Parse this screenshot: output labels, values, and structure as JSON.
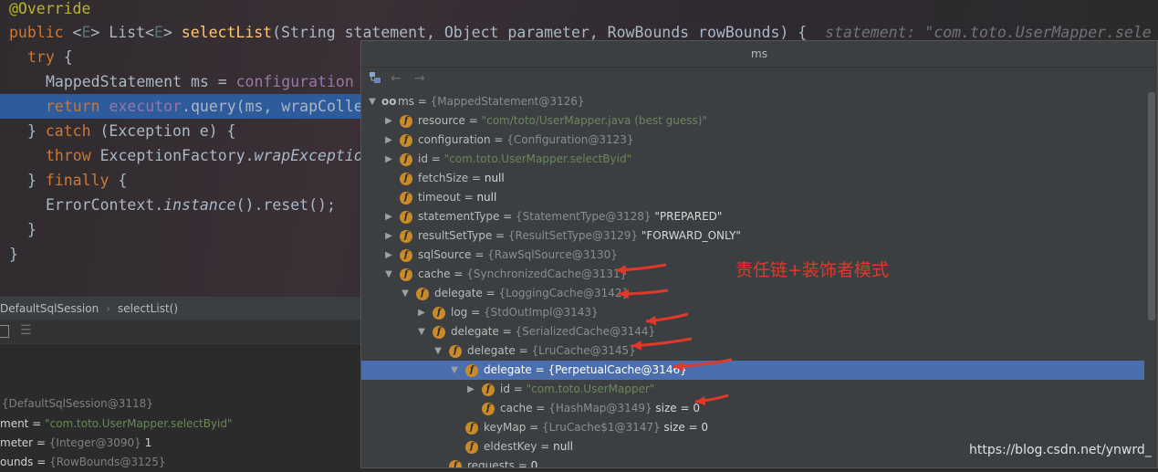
{
  "editor": {
    "lines": {
      "l1": {
        "ann": "@Override"
      },
      "l2": {
        "kw": "public",
        "gen_open": " <",
        "gen": "E",
        "gen_close": "> List<",
        "gen2": "E",
        "gen2_close": "> ",
        "fn": "selectList",
        "args": "(String statement, Object parameter, RowBounds rowBounds) {",
        "hint": "statement: \"com.toto.UserMapper.sele"
      },
      "l3": {
        "kw": "try",
        "rest": " {"
      },
      "l4": {
        "text": "MappedStatement ms = ",
        "field": "configuration"
      },
      "l5": {
        "kw": "return ",
        "field": "executor",
        "rest": ".query(ms, wrapColle"
      },
      "l6": {
        "pre": "} ",
        "kw": "catch",
        "rest": " (Exception e) {"
      },
      "l7": {
        "kw": "throw ",
        "text": "ExceptionFactory.",
        "it": "wrapExceptio"
      },
      "l8": {
        "pre": "} ",
        "kw": "finally",
        "rest": " {"
      },
      "l9": {
        "text": "ErrorContext.",
        "it": "instance",
        "rest": "().reset();"
      },
      "l10": {
        "text": "}"
      },
      "l11": {
        "text": "}"
      }
    }
  },
  "breadcrumb": {
    "class_name": "DefaultSqlSession",
    "method": "selectList()"
  },
  "variables": {
    "rows": [
      {
        "name": "",
        "type": "{DefaultSqlSession@3118}",
        "value": ""
      },
      {
        "name": "ment = ",
        "type": "",
        "value": "\"com.toto.UserMapper.selectByid\""
      },
      {
        "name": "meter = ",
        "type": "{Integer@3090}",
        "value": " 1"
      },
      {
        "name": "ounds = ",
        "type": "{RowBounds@3125}",
        "value": ""
      }
    ]
  },
  "popup": {
    "title": "ms",
    "toolbar": {
      "back": "←",
      "forward": "→"
    },
    "tree": [
      {
        "name": "ms",
        "eq": " = ",
        "type": "{MappedStatement@3126}",
        "str": "",
        "plain": ""
      },
      {
        "name": "resource",
        "eq": " = ",
        "type": "",
        "str": "\"com/toto/UserMapper.java (best guess)\"",
        "plain": ""
      },
      {
        "name": "configuration",
        "eq": " = ",
        "type": "{Configuration@3123}",
        "str": "",
        "plain": ""
      },
      {
        "name": "id",
        "eq": " = ",
        "type": "",
        "str": "\"com.toto.UserMapper.selectByid\"",
        "plain": ""
      },
      {
        "name": "fetchSize",
        "eq": " = ",
        "type": "",
        "str": "",
        "plain": "null"
      },
      {
        "name": "timeout",
        "eq": " = ",
        "type": "",
        "str": "",
        "plain": "null"
      },
      {
        "name": "statementType",
        "eq": " = ",
        "type": "{StatementType@3128}",
        "str": "",
        "plain": " \"PREPARED\""
      },
      {
        "name": "resultSetType",
        "eq": " = ",
        "type": "{ResultSetType@3129}",
        "str": "",
        "plain": " \"FORWARD_ONLY\""
      },
      {
        "name": "sqlSource",
        "eq": " = ",
        "type": "{RawSqlSource@3130}",
        "str": "",
        "plain": ""
      },
      {
        "name": "cache",
        "eq": " = ",
        "type": "{SynchronizedCache@3131}",
        "str": "",
        "plain": ""
      },
      {
        "name": "delegate",
        "eq": " = ",
        "type": "{LoggingCache@3142}",
        "str": "",
        "plain": ""
      },
      {
        "name": "log",
        "eq": " = ",
        "type": "{StdOutImpl@3143}",
        "str": "",
        "plain": ""
      },
      {
        "name": "delegate",
        "eq": " = ",
        "type": "{SerializedCache@3144}",
        "str": "",
        "plain": ""
      },
      {
        "name": "delegate",
        "eq": " = ",
        "type": "{LruCache@3145}",
        "str": "",
        "plain": ""
      },
      {
        "name": "delegate",
        "eq": " = ",
        "type": "{PerpetualCache@3146}",
        "str": "",
        "plain": ""
      },
      {
        "name": "id",
        "eq": " = ",
        "type": "",
        "str": "\"com.toto.UserMapper\"",
        "plain": ""
      },
      {
        "name": "cache",
        "eq": " = ",
        "type": "{HashMap@3149}",
        "str": "",
        "plain": "  size = 0"
      },
      {
        "name": "keyMap",
        "eq": " = ",
        "type": "{LruCache$1@3147}",
        "str": "",
        "plain": "  size = 0"
      },
      {
        "name": "eldestKey",
        "eq": " = ",
        "type": "",
        "str": "",
        "plain": "null"
      },
      {
        "name": "requests",
        "eq": " = ",
        "type": "",
        "str": "",
        "plain": "0"
      }
    ]
  },
  "annotation": {
    "text": "责任链+装饰者模式",
    "color": "#e0392b"
  },
  "watermark": "https://blog.csdn.net/ynwrd_",
  "colors": {
    "selection": "#4b6eaf",
    "field_icon": "#c98a2a",
    "string": "#6a8759",
    "keyword": "#cc7832"
  }
}
